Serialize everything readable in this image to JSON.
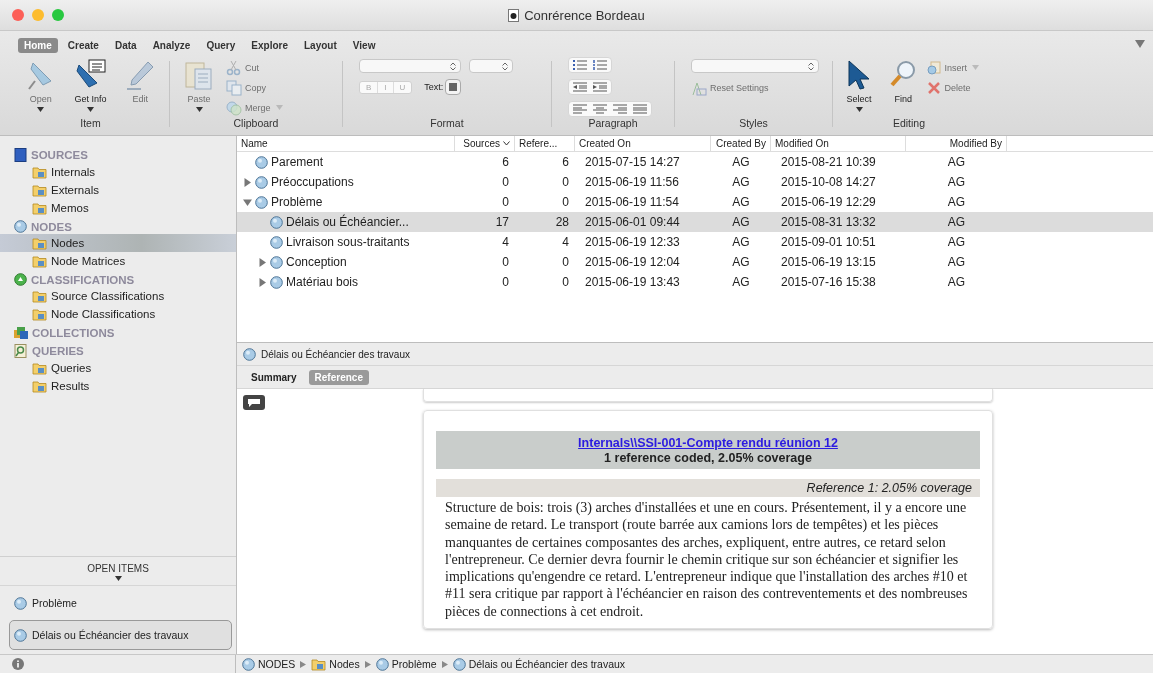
{
  "window": {
    "title": "Conrérence Bordeau"
  },
  "ribbon": {
    "tabs": [
      {
        "label": "Home",
        "selected": true
      },
      {
        "label": "Create",
        "selected": false
      },
      {
        "label": "Data",
        "selected": false
      },
      {
        "label": "Analyze",
        "selected": false
      },
      {
        "label": "Query",
        "selected": false
      },
      {
        "label": "Explore",
        "selected": false
      },
      {
        "label": "Layout",
        "selected": false
      },
      {
        "label": "View",
        "selected": false
      }
    ],
    "item": {
      "label": "Item",
      "buttons": [
        {
          "label": "Open",
          "disabled": true,
          "menu": true
        },
        {
          "label": "Get Info",
          "disabled": false,
          "menu": true
        },
        {
          "label": "Edit",
          "disabled": true,
          "menu": false
        }
      ]
    },
    "clipboard": {
      "label": "Clipboard",
      "paste": {
        "label": "Paste",
        "disabled": true,
        "menu": true
      },
      "small": [
        {
          "label": "Cut",
          "disabled": true,
          "menu": false
        },
        {
          "label": "Copy",
          "disabled": true,
          "menu": false
        },
        {
          "label": "Merge",
          "disabled": true,
          "menu": true
        }
      ]
    },
    "format": {
      "label": "Format",
      "styles": [
        "B",
        "I",
        "U"
      ],
      "text_label": "Text:"
    },
    "paragraph": {
      "label": "Paragraph"
    },
    "styles": {
      "label": "Styles",
      "reset": {
        "label": "Reset Settings",
        "disabled": true
      }
    },
    "editing": {
      "label": "Editing",
      "buttons": [
        {
          "label": "Select",
          "disabled": false,
          "menu": true
        },
        {
          "label": "Find",
          "disabled": false,
          "menu": false
        }
      ],
      "small": [
        {
          "label": "Insert",
          "disabled": true,
          "menu": true
        },
        {
          "label": "Delete",
          "disabled": true,
          "menu": false
        }
      ]
    }
  },
  "sidebar": {
    "sections": [
      {
        "title": "SOURCES",
        "items": [
          {
            "label": "Internals",
            "selected": false
          },
          {
            "label": "Externals",
            "selected": false
          },
          {
            "label": "Memos",
            "selected": false
          }
        ]
      },
      {
        "title": "NODES",
        "items": [
          {
            "label": "Nodes",
            "selected": true
          },
          {
            "label": "Node Matrices",
            "selected": false
          }
        ]
      },
      {
        "title": "CLASSIFICATIONS",
        "items": [
          {
            "label": "Source Classifications",
            "selected": false
          },
          {
            "label": "Node Classifications",
            "selected": false
          }
        ]
      },
      {
        "title": "COLLECTIONS"
      },
      {
        "title": "QUERIES",
        "items": [
          {
            "label": "Queries",
            "selected": false
          },
          {
            "label": "Results",
            "selected": false
          }
        ]
      }
    ],
    "open_items_title": "OPEN ITEMS",
    "open_items": [
      {
        "label": "Problème",
        "selected": false
      },
      {
        "label": "Délais ou Échéancier des travaux",
        "selected": true
      }
    ]
  },
  "table": {
    "columns": [
      {
        "label": "Name",
        "sorted": false
      },
      {
        "label": "Sources",
        "sorted": true
      },
      {
        "label": "Refere...",
        "sorted": false
      },
      {
        "label": "Created On",
        "sorted": false
      },
      {
        "label": "Created By",
        "sorted": false
      },
      {
        "label": "Modified On",
        "sorted": false
      },
      {
        "label": "Modified By",
        "sorted": false
      }
    ],
    "rows": [
      {
        "name": "Parement",
        "sources": "6",
        "references": "6",
        "created_on": "2015-07-15 14:27",
        "created_by": "AG",
        "modified_on": "2015-08-21 10:39",
        "modified_by": "AG",
        "selected": false
      },
      {
        "name": "Préoccupations",
        "sources": "0",
        "references": "0",
        "created_on": "2015-06-19 11:56",
        "created_by": "AG",
        "modified_on": "2015-10-08 14:27",
        "modified_by": "AG",
        "selected": false,
        "expanded": false
      },
      {
        "name": "Problème",
        "sources": "0",
        "references": "0",
        "created_on": "2015-06-19 11:54",
        "created_by": "AG",
        "modified_on": "2015-06-19 12:29",
        "modified_by": "AG",
        "selected": false,
        "expanded": true,
        "children": [
          {
            "name": "Délais ou Échéancier...",
            "sources": "17",
            "references": "28",
            "created_on": "2015-06-01 09:44",
            "created_by": "AG",
            "modified_on": "2015-08-31 13:32",
            "modified_by": "AG",
            "selected": true
          },
          {
            "name": "Livraison sous-traitants",
            "sources": "4",
            "references": "4",
            "created_on": "2015-06-19 12:33",
            "created_by": "AG",
            "modified_on": "2015-09-01 10:51",
            "modified_by": "AG",
            "selected": false
          },
          {
            "name": "Conception",
            "sources": "0",
            "references": "0",
            "created_on": "2015-06-19 12:04",
            "created_by": "AG",
            "modified_on": "2015-06-19 13:15",
            "modified_by": "AG",
            "selected": false,
            "expanded": false
          },
          {
            "name": "Matériau bois",
            "sources": "0",
            "references": "0",
            "created_on": "2015-06-19 13:43",
            "created_by": "AG",
            "modified_on": "2015-07-16 15:38",
            "modified_by": "AG",
            "selected": false,
            "expanded": false
          }
        ]
      }
    ]
  },
  "detail": {
    "title": "Délais ou Échéancier des travaux",
    "tabs": [
      {
        "label": "Summary",
        "selected": false
      },
      {
        "label": "Reference",
        "selected": true
      }
    ],
    "document": {
      "link": "Internals\\\\SSI-001-Compte rendu réunion 12",
      "summary": "1 reference coded, 2.05% coverage",
      "reference_title": "Reference 1: 2.05% coverage",
      "text": "Structure de bois: trois (3) arches d'installées et une en cours. Présentement, il y a encore une semaine de retard. Le transport (route barrée aux camions lors de tempêtes) et les pièces manquantes de certaines composantes des arches, expliquent, entre autres, ce retard selon l'entrepreneur. Ce dernier devra fournir le chemin critique sur son échéancier et signifier les implications qu'engendre ce retard. L'entrepreneur indique que l'installation des arches #10 et #11 sera critique par rapport à l'échéancier en raison des contreventements et des nombreuses pièces de connections à cet endroit."
    }
  },
  "breadcrumb": [
    {
      "label": "NODES",
      "kind": "node"
    },
    {
      "label": "Nodes",
      "kind": "folder"
    },
    {
      "label": "Problème",
      "kind": "node"
    },
    {
      "label": "Délais ou Échéancier des travaux",
      "kind": "node"
    }
  ]
}
